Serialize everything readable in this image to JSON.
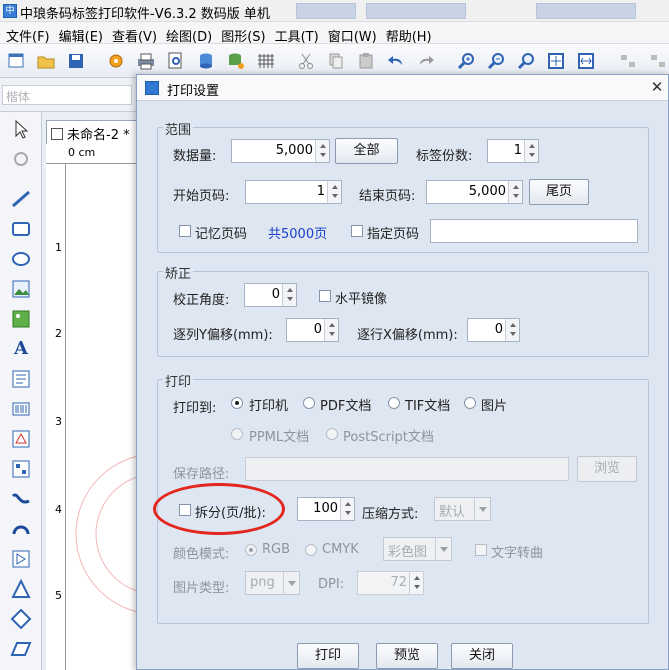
{
  "window": {
    "title": "中琅条码标签打印软件-V6.3.2 数码版 单机"
  },
  "menu": [
    "文件(F)",
    "编辑(E)",
    "查看(V)",
    "绘图(D)",
    "图形(S)",
    "工具(T)",
    "窗口(W)",
    "帮助(H)"
  ],
  "fontbar": {
    "font_placeholder": "楷体"
  },
  "document": {
    "tab": "未命名-2 *",
    "ruler_unit": "0 cm",
    "ruler_marks": [
      "1",
      "2",
      "3",
      "4",
      "5"
    ]
  },
  "dialog": {
    "title": "打印设置",
    "range": {
      "group": "范围",
      "data_qty_label": "数据量:",
      "data_qty": "5,000",
      "all_button": "全部",
      "copies_label": "标签份数:",
      "copies": "1",
      "start_page_label": "开始页码:",
      "start_page": "1",
      "end_page_label": "结束页码:",
      "end_page": "5,000",
      "last_page_button": "尾页",
      "remember_label": "记忆页码",
      "total_pages": "共5000页",
      "specify_label": "指定页码",
      "specify_value": ""
    },
    "correction": {
      "group": "矫正",
      "angle_label": "校正角度:",
      "angle": "0",
      "mirror_label": "水平镜像",
      "y_offset_label": "逐列Y偏移(mm):",
      "y_offset": "0",
      "x_offset_label": "逐行X偏移(mm):",
      "x_offset": "0"
    },
    "print": {
      "group": "打印",
      "print_to_label": "打印到:",
      "targets": [
        "打印机",
        "PDF文档",
        "TIF文档",
        "图片"
      ],
      "targets_disabled": [
        "PPML文档",
        "PostScript文档"
      ],
      "save_path_label": "保存路径:",
      "save_path": "",
      "browse_button": "浏览",
      "split_label": "拆分(页/批):",
      "split_value": "100",
      "compress_label": "压缩方式:",
      "compress_value": "默认",
      "color_mode_label": "颜色模式:",
      "color_modes": [
        "RGB",
        "CMYK"
      ],
      "color_value": "彩色图",
      "text_to_curve_label": "文字转曲",
      "image_type_label": "图片类型:",
      "image_type_value": "png",
      "dpi_label": "DPI:",
      "dpi_value": "72"
    },
    "buttons": {
      "print": "打印",
      "preview": "预览",
      "close": "关闭"
    }
  },
  "colors": {
    "accent": "#e3261e",
    "link": "#1a3fc8"
  }
}
